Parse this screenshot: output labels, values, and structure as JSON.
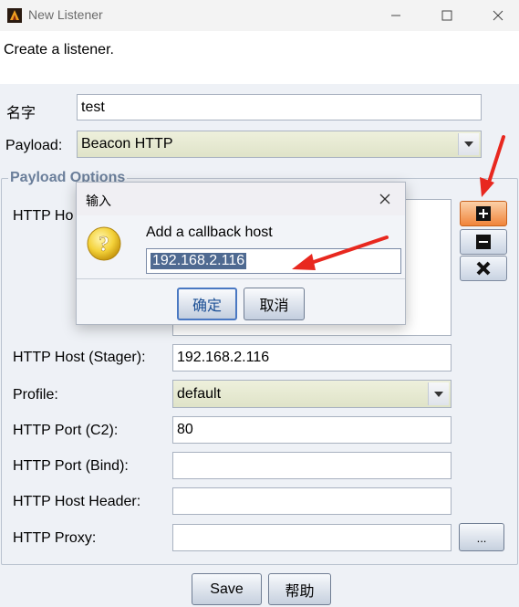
{
  "window": {
    "title": "New Listener",
    "icon": "app-icon",
    "controls": {
      "minimize": "minimize-icon",
      "maximize": "maximize-icon",
      "close": "close-icon"
    }
  },
  "header": {
    "text": "Create a listener."
  },
  "form": {
    "name_label": "名字",
    "name_value": "test",
    "payload_label": "Payload:",
    "payload_value": "Beacon HTTP"
  },
  "payload_options": {
    "title": "Payload Options",
    "hosts_label": "HTTP Ho",
    "host_stager_label": "HTTP Host (Stager):",
    "host_stager_value": "192.168.2.116",
    "profile_label": "Profile:",
    "profile_value": "default",
    "port_c2_label": "HTTP Port (C2):",
    "port_c2_value": "80",
    "port_bind_label": "HTTP Port (Bind):",
    "port_bind_value": "",
    "host_header_label": "HTTP Host Header:",
    "host_header_value": "",
    "proxy_label": "HTTP Proxy:",
    "proxy_value": "",
    "proxy_button": "...",
    "side_buttons": [
      "add-icon",
      "remove-icon",
      "clear-icon"
    ]
  },
  "footer": {
    "save_label": "Save",
    "help_label": "帮助"
  },
  "dialog": {
    "title": "输入",
    "prompt": "Add a callback host",
    "input_value": "192.168.2.116",
    "ok_label": "确定",
    "cancel_label": "取消",
    "icon": "question-icon"
  },
  "colors": {
    "annotation_arrow": "#e8281f",
    "selection": "#4f6a91",
    "accent": "#4a78c2"
  }
}
